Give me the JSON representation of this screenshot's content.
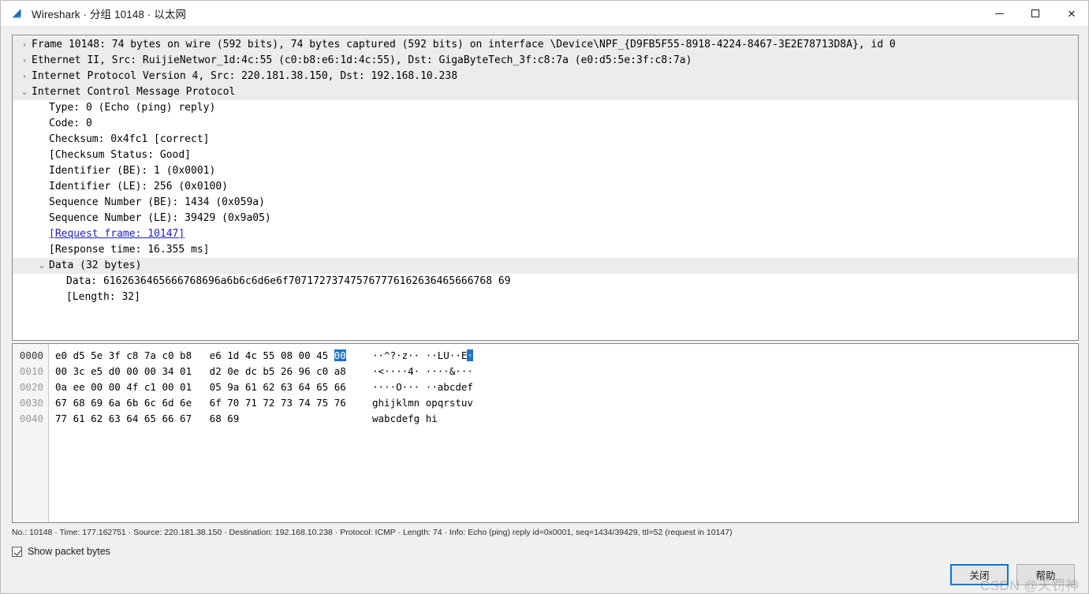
{
  "window": {
    "title": "Wireshark · 分组 10148 · 以太网",
    "logo_icon": "wireshark-fin-icon",
    "minimize_icon": "minimize-icon",
    "maximize_icon": "maximize-icon",
    "close_icon": "close-icon",
    "accent_color": "#0078d7",
    "selection_color": "#1d74c8",
    "link_color": "#2020c8"
  },
  "detail_tree": {
    "rows": [
      {
        "twist": "›",
        "level": 0,
        "selected": true,
        "text": "Frame 10148: 74 bytes on wire (592 bits), 74 bytes captured (592 bits) on interface \\Device\\NPF_{D9FB5F55-8918-4224-8467-3E2E78713D8A}, id 0"
      },
      {
        "twist": "›",
        "level": 0,
        "selected": true,
        "text": "Ethernet II, Src: RuijieNetwor_1d:4c:55 (c0:b8:e6:1d:4c:55), Dst: GigaByteTech_3f:c8:7a (e0:d5:5e:3f:c8:7a)"
      },
      {
        "twist": "›",
        "level": 0,
        "selected": true,
        "text": "Internet Protocol Version 4, Src: 220.181.38.150, Dst: 192.168.10.238"
      },
      {
        "twist": "⌄",
        "level": 0,
        "selected": true,
        "text": "Internet Control Message Protocol"
      },
      {
        "twist": "",
        "level": 1,
        "selected": false,
        "text": "Type: 0 (Echo (ping) reply)"
      },
      {
        "twist": "",
        "level": 1,
        "selected": false,
        "text": "Code: 0"
      },
      {
        "twist": "",
        "level": 1,
        "selected": false,
        "text": "Checksum: 0x4fc1 [correct]"
      },
      {
        "twist": "",
        "level": 1,
        "selected": false,
        "text": "[Checksum Status: Good]"
      },
      {
        "twist": "",
        "level": 1,
        "selected": false,
        "text": "Identifier (BE): 1 (0x0001)"
      },
      {
        "twist": "",
        "level": 1,
        "selected": false,
        "text": "Identifier (LE): 256 (0x0100)"
      },
      {
        "twist": "",
        "level": 1,
        "selected": false,
        "text": "Sequence Number (BE): 1434 (0x059a)"
      },
      {
        "twist": "",
        "level": 1,
        "selected": false,
        "text": "Sequence Number (LE): 39429 (0x9a05)"
      },
      {
        "twist": "",
        "level": 1,
        "selected": false,
        "text": "[Request frame: 10147]",
        "link": true
      },
      {
        "twist": "",
        "level": 1,
        "selected": false,
        "text": "[Response time: 16.355 ms]"
      },
      {
        "twist": "⌄",
        "level": 1,
        "selected": true,
        "text": "Data (32 bytes)"
      },
      {
        "twist": "",
        "level": 2,
        "selected": false,
        "text": "Data: 6162636465666768696a6b6c6d6e6f707172737475767776162636465666768 69"
      },
      {
        "twist": "",
        "level": 2,
        "selected": false,
        "text": "[Length: 32]"
      }
    ]
  },
  "hex_dump": {
    "rows": [
      {
        "offset": "0000",
        "left": "e0 d5 5e 3f c8 7a c0 b8",
        "right_pre": "e6 1d 4c 55 08 00 45 ",
        "right_hl": "00",
        "ascii_pre": "··^?·z·· ··LU··E",
        "ascii_hl": "·"
      },
      {
        "offset": "0010",
        "left": "00 3c e5 d0 00 00 34 01",
        "right_pre": "d2 0e dc b5 26 96 c0 a8",
        "right_hl": "",
        "ascii_pre": "·<····4· ····&···",
        "ascii_hl": ""
      },
      {
        "offset": "0020",
        "left": "0a ee 00 00 4f c1 00 01",
        "right_pre": "05 9a 61 62 63 64 65 66",
        "right_hl": "",
        "ascii_pre": "····O··· ··abcdef",
        "ascii_hl": ""
      },
      {
        "offset": "0030",
        "left": "67 68 69 6a 6b 6c 6d 6e",
        "right_pre": "6f 70 71 72 73 74 75 76",
        "right_hl": "",
        "ascii_pre": "ghijklmn opqrstuv",
        "ascii_hl": ""
      },
      {
        "offset": "0040",
        "left": "77 61 62 63 64 65 66 67",
        "right_pre": "68 69",
        "right_hl": "",
        "ascii_pre": "wabcdefg hi",
        "ascii_hl": ""
      }
    ]
  },
  "status": {
    "text": "No.: 10148 · Time: 177.162751 · Source: 220.181.38.150 · Destination: 192.168.10.238 · Protocol: ICMP · Length: 74 · Info: Echo (ping) reply id=0x0001, seq=1434/39429, ttl=52 (request in 10147)"
  },
  "footer": {
    "show_packet_bytes_label": "Show packet bytes",
    "show_packet_bytes_checked": true,
    "close_label": "关闭",
    "help_label": "帮助"
  },
  "watermark": {
    "text": "CSDN @天罚神"
  }
}
